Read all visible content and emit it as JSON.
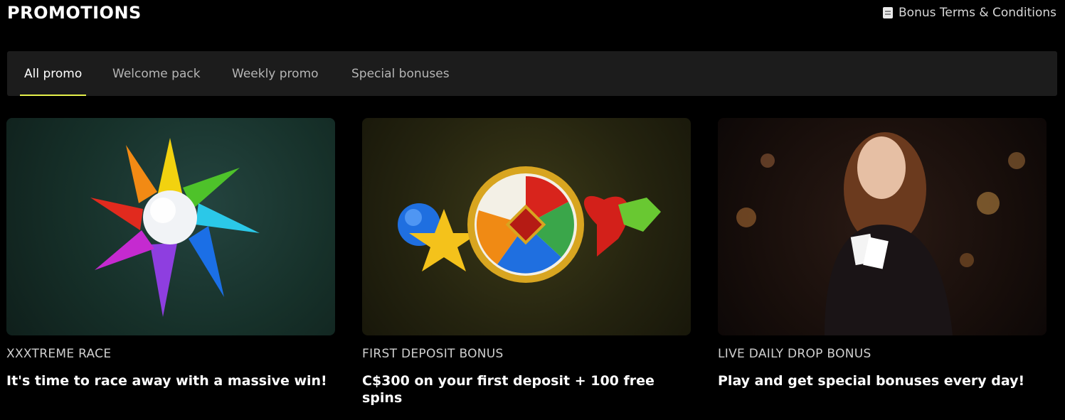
{
  "header": {
    "title": "PROMOTIONS",
    "terms_label": "Bonus Terms & Conditions"
  },
  "tabs": [
    {
      "label": "All promo",
      "active": true
    },
    {
      "label": "Welcome pack",
      "active": false
    },
    {
      "label": "Weekly promo",
      "active": false
    },
    {
      "label": "Special bonuses",
      "active": false
    }
  ],
  "cards": [
    {
      "category": "XXXTREME RACE",
      "description": "It's time to race away with a massive win!",
      "image": "gem-star-illustration"
    },
    {
      "category": "FIRST DEPOSIT BONUS",
      "description": "C$300 on your first deposit + 100 free spins",
      "image": "gem-flower-illustration"
    },
    {
      "category": "LIVE DAILY DROP BONUS",
      "description": "Play and get special bonuses every day!",
      "image": "woman-holding-aces-photo"
    }
  ],
  "colors": {
    "accent": "#e6f04a",
    "background": "#000000",
    "tab_bar": "#1c1c1c"
  }
}
